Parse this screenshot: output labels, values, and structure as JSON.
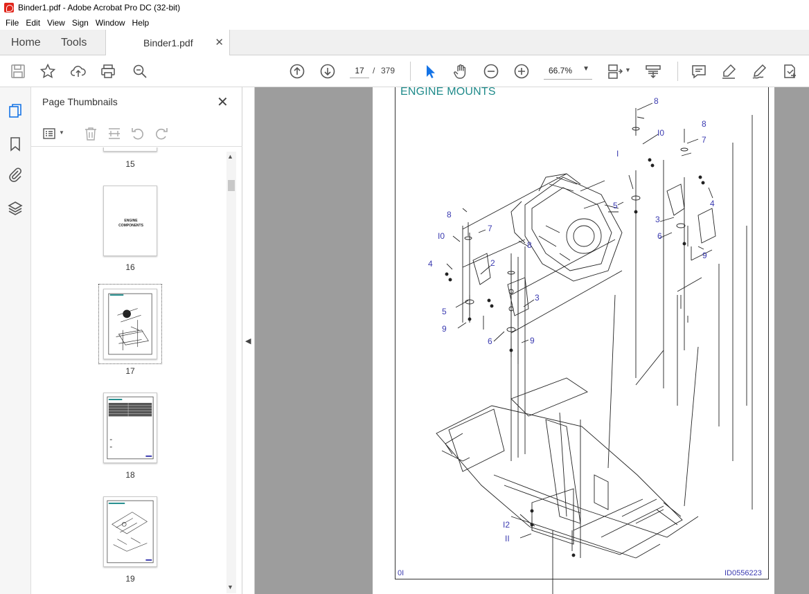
{
  "window": {
    "title": "Binder1.pdf - Adobe Acrobat Pro DC (32-bit)"
  },
  "menu": [
    "File",
    "Edit",
    "View",
    "Sign",
    "Window",
    "Help"
  ],
  "tabs": {
    "home": "Home",
    "tools": "Tools",
    "document": "Binder1.pdf"
  },
  "toolbar": {
    "current_page": "17",
    "page_separator": "/",
    "total_pages": "379",
    "zoom": "66.7%"
  },
  "panel": {
    "title": "Page Thumbnails",
    "thumbnails": [
      {
        "label": "15",
        "text": ""
      },
      {
        "label": "16",
        "text": "ENGINE COMPONENTS"
      },
      {
        "label": "17",
        "text": ""
      },
      {
        "label": "18",
        "text": ""
      },
      {
        "label": "19",
        "text": ""
      }
    ]
  },
  "page": {
    "heading": "ENGINE MOUNTS",
    "footer_left": "0I",
    "footer_right": "ID0556223",
    "callouts": [
      "8",
      "I0",
      "8",
      "7",
      "I",
      "4",
      "5",
      "3",
      "6",
      "9",
      "8",
      "7",
      "I0",
      "8",
      "4",
      "2",
      "3",
      "5",
      "9",
      "6",
      "9",
      "I2",
      "II"
    ]
  }
}
